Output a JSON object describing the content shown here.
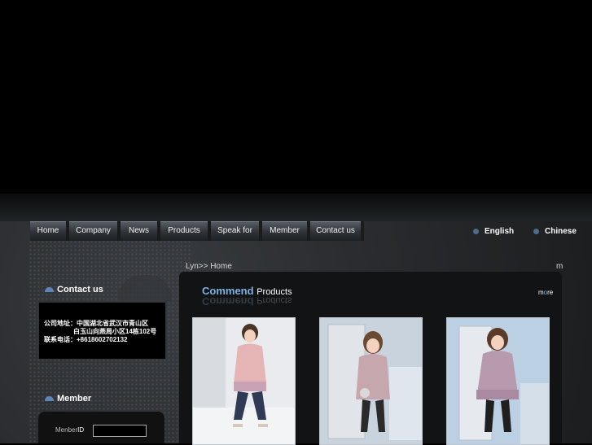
{
  "nav": {
    "items": [
      {
        "label": "Home",
        "name": "nav-home"
      },
      {
        "label": "Company",
        "name": "nav-company"
      },
      {
        "label": "News",
        "name": "nav-news"
      },
      {
        "label": "Products",
        "name": "nav-products"
      },
      {
        "label": "Speak for",
        "name": "nav-speak-for"
      },
      {
        "label": "Member",
        "name": "nav-member"
      },
      {
        "label": "Contact us",
        "name": "nav-contact-us"
      }
    ]
  },
  "languages": {
    "english": "English",
    "chinese": "Chinese"
  },
  "breadcrumb": {
    "text": "Lyn>> Home",
    "trailing": "m"
  },
  "commend": {
    "title": "Commend",
    "subtitle": "Products",
    "more_m": "m",
    "more_o": "o",
    "more_re": "re"
  },
  "sidebar": {
    "contact_title": "Contact us",
    "contact_lines": [
      "公司地址：中国湖北省武汉市青山区",
      "白玉山向燕局小区14栋102号",
      "联系电话：+8618602702132"
    ],
    "member_title": "Member",
    "member_label_a": "Menber",
    "member_label_b": "ID",
    "member_value": ""
  },
  "colors": {
    "accent": "#7fb1e3",
    "nav_bg": "#2f3338"
  }
}
